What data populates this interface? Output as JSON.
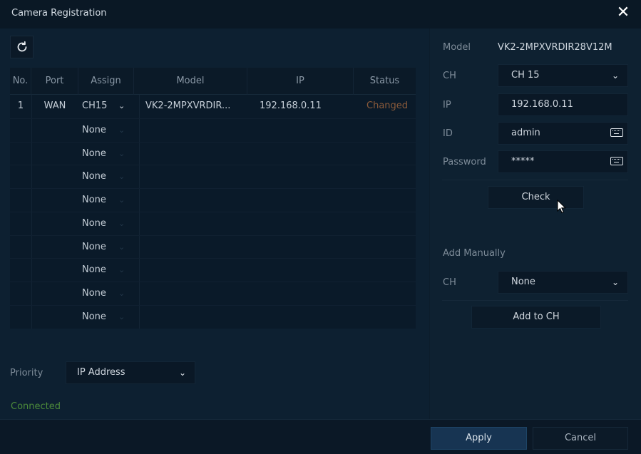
{
  "window": {
    "title": "Camera Registration"
  },
  "icons": {
    "close": "close-icon",
    "refresh": "refresh-icon",
    "keyboard": "keyboard-icon",
    "chevron": "chevron-down-icon"
  },
  "table": {
    "headers": [
      "No.",
      "Port",
      "Assign",
      "Model",
      "IP",
      "Status"
    ],
    "rows": [
      {
        "no": "1",
        "port": "WAN",
        "assign": "CH15",
        "model": "VK2-2MPXVRDIR...",
        "ip": "192.168.0.11",
        "status": "Changed"
      },
      {
        "no": "",
        "port": "",
        "assign": "None",
        "model": "",
        "ip": "",
        "status": ""
      },
      {
        "no": "",
        "port": "",
        "assign": "None",
        "model": "",
        "ip": "",
        "status": ""
      },
      {
        "no": "",
        "port": "",
        "assign": "None",
        "model": "",
        "ip": "",
        "status": ""
      },
      {
        "no": "",
        "port": "",
        "assign": "None",
        "model": "",
        "ip": "",
        "status": ""
      },
      {
        "no": "",
        "port": "",
        "assign": "None",
        "model": "",
        "ip": "",
        "status": ""
      },
      {
        "no": "",
        "port": "",
        "assign": "None",
        "model": "",
        "ip": "",
        "status": ""
      },
      {
        "no": "",
        "port": "",
        "assign": "None",
        "model": "",
        "ip": "",
        "status": ""
      },
      {
        "no": "",
        "port": "",
        "assign": "None",
        "model": "",
        "ip": "",
        "status": ""
      },
      {
        "no": "",
        "port": "",
        "assign": "None",
        "model": "",
        "ip": "",
        "status": ""
      }
    ]
  },
  "priority": {
    "label": "Priority",
    "value": "IP Address"
  },
  "connection_status": "Connected",
  "details": {
    "model_label": "Model",
    "model_value": "VK2-2MPXVRDIR28V12M",
    "ch_label": "CH",
    "ch_value": "CH 15",
    "ip_label": "IP",
    "ip_value": "192.168.0.11",
    "id_label": "ID",
    "id_value": "admin",
    "password_label": "Password",
    "password_value": "*****",
    "check_label": "Check"
  },
  "add_manually": {
    "title": "Add Manually",
    "ch_label": "CH",
    "ch_value": "None",
    "add_label": "Add to CH"
  },
  "footer": {
    "apply_label": "Apply",
    "cancel_label": "Cancel"
  },
  "colors": {
    "background": "#0c1c2b",
    "accent": "#173452",
    "status_changed": "#8a5a3a",
    "connected": "#4c8a3a"
  }
}
